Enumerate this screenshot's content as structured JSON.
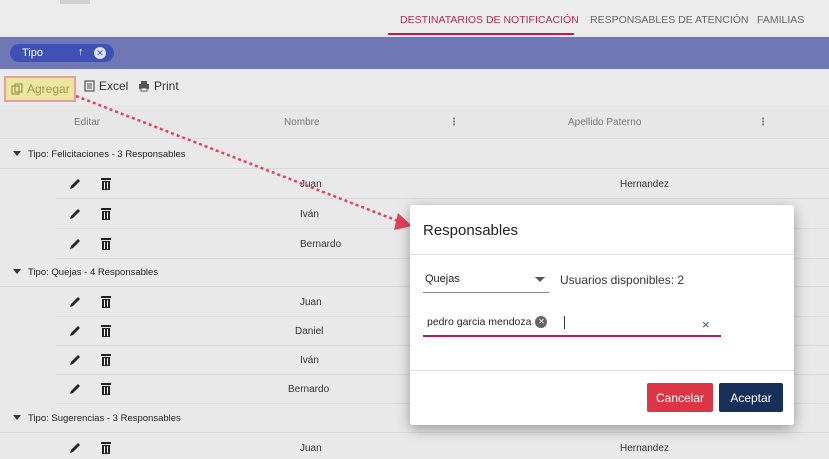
{
  "tabs": [
    {
      "label": "DESTINATARIOS DE NOTIFICACIÓN",
      "active": true
    },
    {
      "label": "RESPONSABLES DE ATENCIÓN",
      "active": false
    },
    {
      "label": "FAMILIAS",
      "active": false
    }
  ],
  "groupbar": {
    "chip_label": "Tipo",
    "sort_icon": "arrow-up-icon",
    "remove_icon": "close-icon"
  },
  "toolbar": {
    "add_label": "Agregar",
    "excel_label": "Excel",
    "print_label": "Print"
  },
  "columns": [
    "Editar",
    "Nombre",
    "⋮",
    "Apellido Paterno",
    "⋮"
  ],
  "groups": [
    {
      "label": "Tipo: Felicitaciones - 3 Responsables",
      "rows": [
        {
          "nombre": "Juan",
          "paterno": "Hernandez"
        },
        {
          "nombre": "Iván",
          "paterno": ""
        },
        {
          "nombre": "Bernardo",
          "paterno": ""
        }
      ]
    },
    {
      "label": "Tipo: Quejas - 4 Responsables",
      "rows": [
        {
          "nombre": "Juan",
          "paterno": ""
        },
        {
          "nombre": "Daniel",
          "paterno": ""
        },
        {
          "nombre": "Iván",
          "paterno": ""
        },
        {
          "nombre": "Bernardo",
          "paterno": ""
        }
      ]
    },
    {
      "label": "Tipo: Sugerencias - 3 Responsables",
      "rows": [
        {
          "nombre": "Juan",
          "paterno": "Hernandez"
        }
      ]
    }
  ],
  "modal": {
    "title": "Responsables",
    "select_value": "Quejas",
    "available": "Usuarios disponibles: 2",
    "selected_chip": "pedro garcia mendoza",
    "clear_symbol": "×",
    "cancel_label": "Cancelar",
    "accept_label": "Aceptar"
  },
  "colors": {
    "accent": "#c2185b",
    "groupbar": "#6f78b4",
    "chip": "#3f51b5",
    "cancel": "#dc3545",
    "accept": "#17305a",
    "annotation_arrow": "#e0435a"
  }
}
